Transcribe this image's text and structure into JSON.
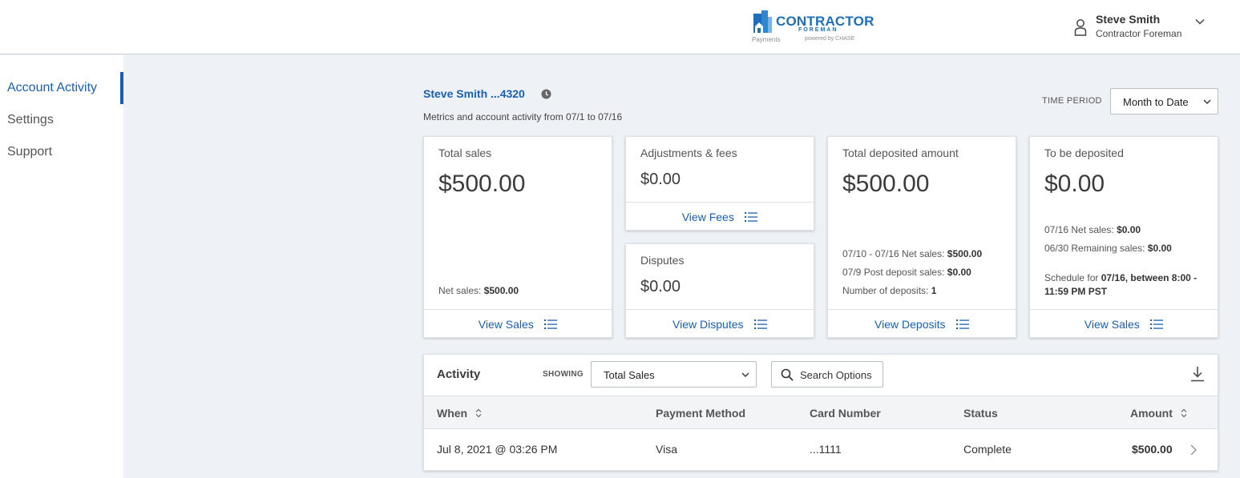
{
  "header": {
    "logo": {
      "name": "CONTRACTOR",
      "sub": "FOREMAN",
      "payments": "Payments",
      "powered": "powered by CHASE",
      "brand_color": "#1e6fb8"
    },
    "user": {
      "name": "Steve Smith",
      "company": "Contractor Foreman"
    }
  },
  "sidebar": {
    "items": [
      {
        "label": "Account Activity",
        "active": true
      },
      {
        "label": "Settings",
        "active": false
      },
      {
        "label": "Support",
        "active": false
      }
    ]
  },
  "account": {
    "name": "Steve Smith ...4320",
    "subtitle": "Metrics and account activity from 07/1 to 07/16",
    "time_period_label": "TIME PERIOD",
    "time_period_value": "Month to Date"
  },
  "cards": {
    "total_sales": {
      "title": "Total sales",
      "value": "$500.00",
      "net_label": "Net sales:",
      "net_value": "$500.00",
      "link": "View Sales"
    },
    "adjustments": {
      "title": "Adjustments & fees",
      "value": "$0.00",
      "link": "View Fees"
    },
    "disputes": {
      "title": "Disputes",
      "value": "$0.00",
      "link": "View Disputes"
    },
    "deposited": {
      "title": "Total deposited amount",
      "value": "$500.00",
      "line1_label": "07/10 - 07/16 Net sales:",
      "line1_value": "$500.00",
      "line2_label": "07/9 Post deposit sales:",
      "line2_value": "$0.00",
      "line3_label": "Number of deposits:",
      "line3_value": "1",
      "link": "View Deposits"
    },
    "to_deposit": {
      "title": "To be deposited",
      "value": "$0.00",
      "line1_label": "07/16 Net sales:",
      "line1_value": "$0.00",
      "line2_label": "06/30 Remaining sales:",
      "line2_value": "$0.00",
      "schedule_prefix": "Schedule for",
      "schedule_bold1": "07/16, between 8:00 -",
      "schedule_bold2": "11:59 PM PST",
      "link": "View Sales"
    }
  },
  "activity": {
    "title": "Activity",
    "showing_label": "SHOWING",
    "showing_value": "Total Sales",
    "search_label": "Search Options",
    "columns": {
      "when": "When",
      "method": "Payment Method",
      "card": "Card Number",
      "status": "Status",
      "amount": "Amount"
    },
    "rows": [
      {
        "when": "Jul 8, 2021 @ 03:26 PM",
        "method": "Visa",
        "card": "...1111",
        "status": "Complete",
        "amount": "$500.00"
      }
    ]
  },
  "colors": {
    "accent": "#1a5fb4",
    "background": "#eef1f5"
  }
}
